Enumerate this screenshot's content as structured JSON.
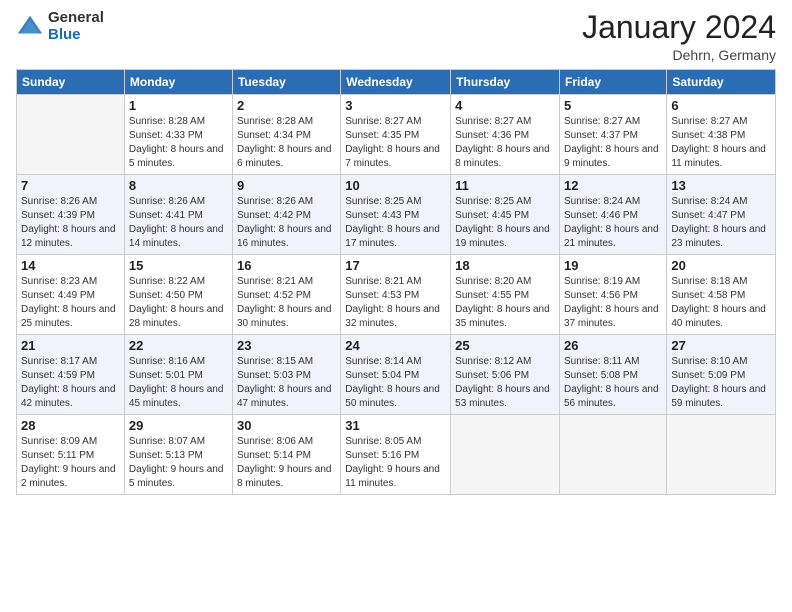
{
  "logo": {
    "general": "General",
    "blue": "Blue"
  },
  "header": {
    "month": "January 2024",
    "location": "Dehrn, Germany"
  },
  "weekdays": [
    "Sunday",
    "Monday",
    "Tuesday",
    "Wednesday",
    "Thursday",
    "Friday",
    "Saturday"
  ],
  "weeks": [
    [
      {
        "day": "",
        "sunrise": "",
        "sunset": "",
        "daylight": ""
      },
      {
        "day": "1",
        "sunrise": "Sunrise: 8:28 AM",
        "sunset": "Sunset: 4:33 PM",
        "daylight": "Daylight: 8 hours and 5 minutes."
      },
      {
        "day": "2",
        "sunrise": "Sunrise: 8:28 AM",
        "sunset": "Sunset: 4:34 PM",
        "daylight": "Daylight: 8 hours and 6 minutes."
      },
      {
        "day": "3",
        "sunrise": "Sunrise: 8:27 AM",
        "sunset": "Sunset: 4:35 PM",
        "daylight": "Daylight: 8 hours and 7 minutes."
      },
      {
        "day": "4",
        "sunrise": "Sunrise: 8:27 AM",
        "sunset": "Sunset: 4:36 PM",
        "daylight": "Daylight: 8 hours and 8 minutes."
      },
      {
        "day": "5",
        "sunrise": "Sunrise: 8:27 AM",
        "sunset": "Sunset: 4:37 PM",
        "daylight": "Daylight: 8 hours and 9 minutes."
      },
      {
        "day": "6",
        "sunrise": "Sunrise: 8:27 AM",
        "sunset": "Sunset: 4:38 PM",
        "daylight": "Daylight: 8 hours and 11 minutes."
      }
    ],
    [
      {
        "day": "7",
        "sunrise": "Sunrise: 8:26 AM",
        "sunset": "Sunset: 4:39 PM",
        "daylight": "Daylight: 8 hours and 12 minutes."
      },
      {
        "day": "8",
        "sunrise": "Sunrise: 8:26 AM",
        "sunset": "Sunset: 4:41 PM",
        "daylight": "Daylight: 8 hours and 14 minutes."
      },
      {
        "day": "9",
        "sunrise": "Sunrise: 8:26 AM",
        "sunset": "Sunset: 4:42 PM",
        "daylight": "Daylight: 8 hours and 16 minutes."
      },
      {
        "day": "10",
        "sunrise": "Sunrise: 8:25 AM",
        "sunset": "Sunset: 4:43 PM",
        "daylight": "Daylight: 8 hours and 17 minutes."
      },
      {
        "day": "11",
        "sunrise": "Sunrise: 8:25 AM",
        "sunset": "Sunset: 4:45 PM",
        "daylight": "Daylight: 8 hours and 19 minutes."
      },
      {
        "day": "12",
        "sunrise": "Sunrise: 8:24 AM",
        "sunset": "Sunset: 4:46 PM",
        "daylight": "Daylight: 8 hours and 21 minutes."
      },
      {
        "day": "13",
        "sunrise": "Sunrise: 8:24 AM",
        "sunset": "Sunset: 4:47 PM",
        "daylight": "Daylight: 8 hours and 23 minutes."
      }
    ],
    [
      {
        "day": "14",
        "sunrise": "Sunrise: 8:23 AM",
        "sunset": "Sunset: 4:49 PM",
        "daylight": "Daylight: 8 hours and 25 minutes."
      },
      {
        "day": "15",
        "sunrise": "Sunrise: 8:22 AM",
        "sunset": "Sunset: 4:50 PM",
        "daylight": "Daylight: 8 hours and 28 minutes."
      },
      {
        "day": "16",
        "sunrise": "Sunrise: 8:21 AM",
        "sunset": "Sunset: 4:52 PM",
        "daylight": "Daylight: 8 hours and 30 minutes."
      },
      {
        "day": "17",
        "sunrise": "Sunrise: 8:21 AM",
        "sunset": "Sunset: 4:53 PM",
        "daylight": "Daylight: 8 hours and 32 minutes."
      },
      {
        "day": "18",
        "sunrise": "Sunrise: 8:20 AM",
        "sunset": "Sunset: 4:55 PM",
        "daylight": "Daylight: 8 hours and 35 minutes."
      },
      {
        "day": "19",
        "sunrise": "Sunrise: 8:19 AM",
        "sunset": "Sunset: 4:56 PM",
        "daylight": "Daylight: 8 hours and 37 minutes."
      },
      {
        "day": "20",
        "sunrise": "Sunrise: 8:18 AM",
        "sunset": "Sunset: 4:58 PM",
        "daylight": "Daylight: 8 hours and 40 minutes."
      }
    ],
    [
      {
        "day": "21",
        "sunrise": "Sunrise: 8:17 AM",
        "sunset": "Sunset: 4:59 PM",
        "daylight": "Daylight: 8 hours and 42 minutes."
      },
      {
        "day": "22",
        "sunrise": "Sunrise: 8:16 AM",
        "sunset": "Sunset: 5:01 PM",
        "daylight": "Daylight: 8 hours and 45 minutes."
      },
      {
        "day": "23",
        "sunrise": "Sunrise: 8:15 AM",
        "sunset": "Sunset: 5:03 PM",
        "daylight": "Daylight: 8 hours and 47 minutes."
      },
      {
        "day": "24",
        "sunrise": "Sunrise: 8:14 AM",
        "sunset": "Sunset: 5:04 PM",
        "daylight": "Daylight: 8 hours and 50 minutes."
      },
      {
        "day": "25",
        "sunrise": "Sunrise: 8:12 AM",
        "sunset": "Sunset: 5:06 PM",
        "daylight": "Daylight: 8 hours and 53 minutes."
      },
      {
        "day": "26",
        "sunrise": "Sunrise: 8:11 AM",
        "sunset": "Sunset: 5:08 PM",
        "daylight": "Daylight: 8 hours and 56 minutes."
      },
      {
        "day": "27",
        "sunrise": "Sunrise: 8:10 AM",
        "sunset": "Sunset: 5:09 PM",
        "daylight": "Daylight: 8 hours and 59 minutes."
      }
    ],
    [
      {
        "day": "28",
        "sunrise": "Sunrise: 8:09 AM",
        "sunset": "Sunset: 5:11 PM",
        "daylight": "Daylight: 9 hours and 2 minutes."
      },
      {
        "day": "29",
        "sunrise": "Sunrise: 8:07 AM",
        "sunset": "Sunset: 5:13 PM",
        "daylight": "Daylight: 9 hours and 5 minutes."
      },
      {
        "day": "30",
        "sunrise": "Sunrise: 8:06 AM",
        "sunset": "Sunset: 5:14 PM",
        "daylight": "Daylight: 9 hours and 8 minutes."
      },
      {
        "day": "31",
        "sunrise": "Sunrise: 8:05 AM",
        "sunset": "Sunset: 5:16 PM",
        "daylight": "Daylight: 9 hours and 11 minutes."
      },
      {
        "day": "",
        "sunrise": "",
        "sunset": "",
        "daylight": ""
      },
      {
        "day": "",
        "sunrise": "",
        "sunset": "",
        "daylight": ""
      },
      {
        "day": "",
        "sunrise": "",
        "sunset": "",
        "daylight": ""
      }
    ]
  ]
}
